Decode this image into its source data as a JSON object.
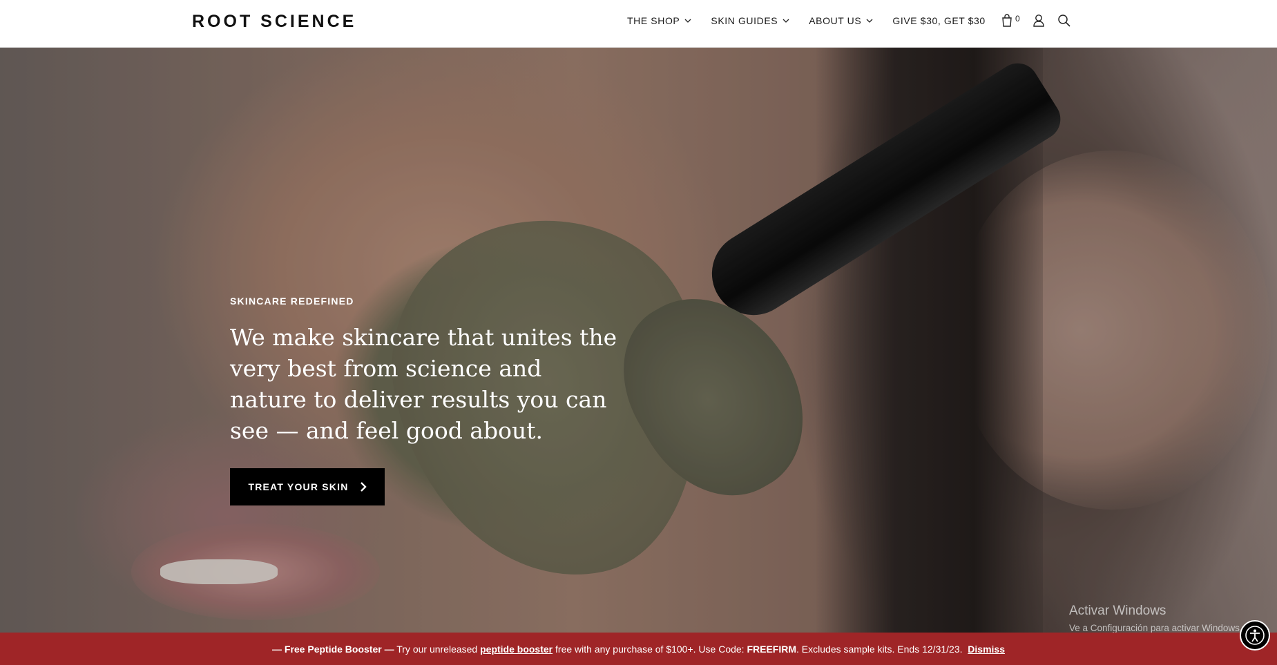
{
  "header": {
    "logo": "ROOT SCIENCE",
    "nav": [
      {
        "label": "THE SHOP",
        "dropdown": true
      },
      {
        "label": "SKIN GUIDES",
        "dropdown": true
      },
      {
        "label": "ABOUT US",
        "dropdown": true
      },
      {
        "label": "GIVE $30, GET $30",
        "dropdown": false
      }
    ],
    "cart_count": "0",
    "icons": [
      "bag-icon",
      "account-icon",
      "search-icon"
    ]
  },
  "hero": {
    "eyebrow": "SKINCARE REDEFINED",
    "headline": "We make skincare that unites the very best from science and nature to deliver results you can see — and feel good about.",
    "cta_label": "TREAT YOUR SKIN"
  },
  "windows_watermark": {
    "title": "Activar Windows",
    "subtitle": "Ve a Configuración para activar Windows."
  },
  "promo": {
    "lead": "— Free Peptide Booster —",
    "text1": " Try our unreleased ",
    "link": "peptide booster",
    "text2": " free with any purchase of $100+. Use Code: ",
    "code": "FREEFIRM",
    "text3": ". Excludes sample kits. Ends 12/31/23.",
    "dismiss": "Dismiss"
  },
  "colors": {
    "promo_bg": "#9f2527",
    "cta_bg": "#000000",
    "header_bg": "#ffffff"
  }
}
